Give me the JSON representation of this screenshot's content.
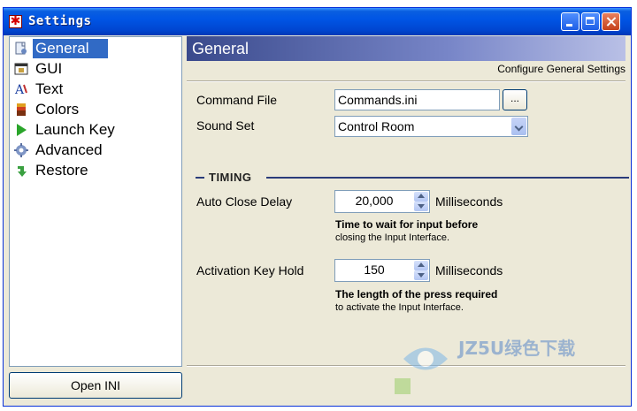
{
  "window": {
    "title": "Settings"
  },
  "sidebar": {
    "items": [
      {
        "label": "General",
        "icon": "general-icon",
        "selected": true
      },
      {
        "label": "GUI",
        "icon": "gui-icon",
        "selected": false
      },
      {
        "label": "Text",
        "icon": "text-icon",
        "selected": false
      },
      {
        "label": "Colors",
        "icon": "colors-icon",
        "selected": false
      },
      {
        "label": "Launch Key",
        "icon": "launch-icon",
        "selected": false
      },
      {
        "label": "Advanced",
        "icon": "advanced-icon",
        "selected": false
      },
      {
        "label": "Restore",
        "icon": "restore-icon",
        "selected": false
      }
    ],
    "open_ini_label": "Open INI"
  },
  "panel": {
    "title": "General",
    "subtitle": "Configure General Settings",
    "command_file": {
      "label": "Command File",
      "value": "Commands.ini",
      "browse_label": "..."
    },
    "sound_set": {
      "label": "Sound Set",
      "value": "Control Room"
    },
    "timing": {
      "title": "TIMING"
    },
    "auto_close": {
      "label": "Auto Close Delay",
      "value": "20,000",
      "unit": "Milliseconds",
      "hint_bold": "Time to wait for input before",
      "hint": "closing the Input Interface."
    },
    "activation": {
      "label": "Activation Key Hold",
      "value": "150",
      "unit": "Milliseconds",
      "hint_bold": "The length of the press required",
      "hint": "to activate the Input Interface."
    }
  },
  "watermark": {
    "text": "JZ5U绿色下载"
  },
  "colors": {
    "titlebar": "#0055e5",
    "selection": "#316ac5",
    "panel_header": "#3a4a8c",
    "face": "#ece9d8"
  }
}
